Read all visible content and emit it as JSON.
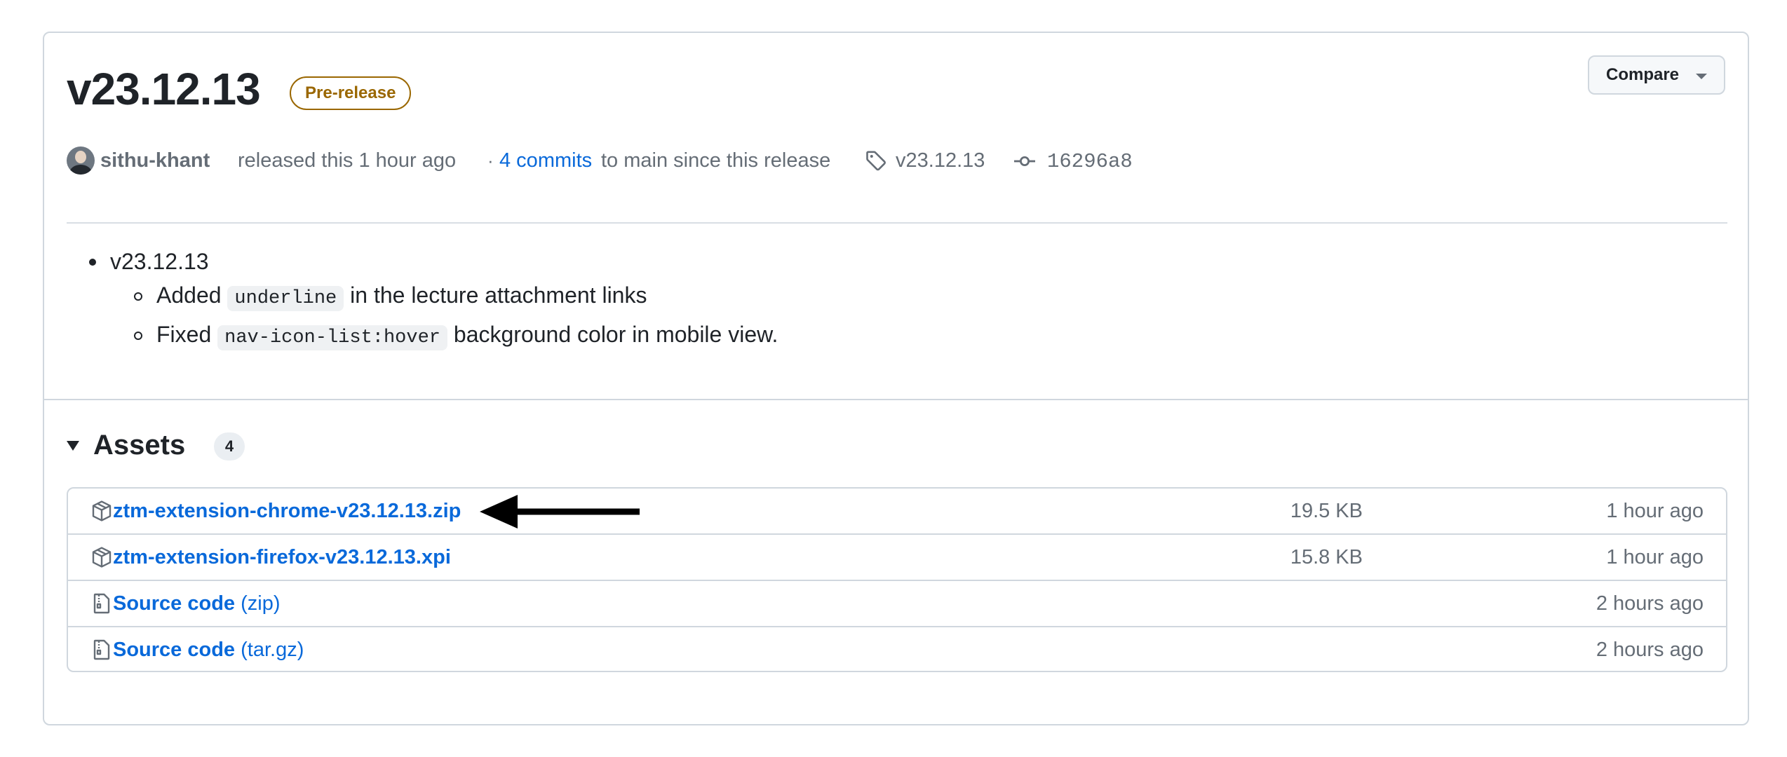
{
  "release": {
    "title": "v23.12.13",
    "badge": "Pre-release",
    "compare_label": "Compare"
  },
  "meta": {
    "author": "sithu-khant",
    "released_text": "released this 1 hour ago",
    "separator": "·",
    "commits_link": "4 commits",
    "commits_rest": "to main since this release",
    "tag": "v23.12.13",
    "commit_sha": "16296a8"
  },
  "notes": {
    "top": "v23.12.13",
    "items": [
      {
        "before": "Added",
        "code": "underline",
        "after": "in the lecture attachment links"
      },
      {
        "before": "Fixed",
        "code": "nav-icon-list:hover",
        "after": "background color in mobile view."
      }
    ]
  },
  "assets": {
    "title": "Assets",
    "count": "4",
    "rows": [
      {
        "icon": "package-icon",
        "name": "ztm-extension-chrome-v23.12.13.zip",
        "suffix": "",
        "size": "19.5 KB",
        "time": "1 hour ago"
      },
      {
        "icon": "package-icon",
        "name": "ztm-extension-firefox-v23.12.13.xpi",
        "suffix": "",
        "size": "15.8 KB",
        "time": "1 hour ago"
      },
      {
        "icon": "file-zip-icon",
        "name": "Source code",
        "suffix": "(zip)",
        "size": "",
        "time": "2 hours ago"
      },
      {
        "icon": "file-zip-icon",
        "name": "Source code",
        "suffix": "(tar.gz)",
        "size": "",
        "time": "2 hours ago"
      }
    ]
  },
  "colors": {
    "link": "#0969da",
    "muted": "#656d76",
    "border": "#d0d7de",
    "prerelease": "#9a6700"
  }
}
